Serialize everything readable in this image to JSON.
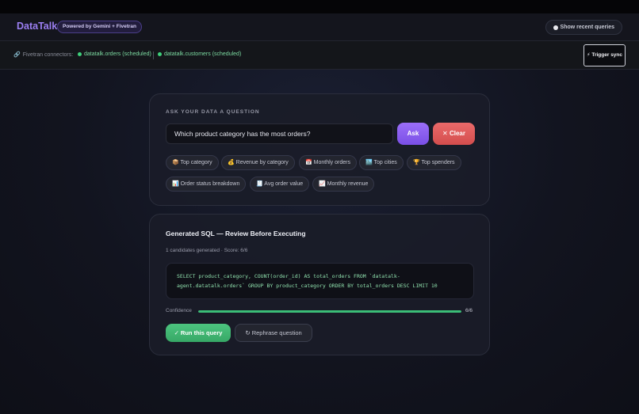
{
  "header": {
    "logo": "DataTalk",
    "badge": "Powered by Gemini + Fivetran",
    "recent_label": "Show recent queries"
  },
  "connectors": {
    "label": "Fivetran connectors:",
    "items": [
      "datatalk.orders (scheduled)",
      "datatalk.customers (scheduled)"
    ],
    "sync_label": "⚡ Trigger sync"
  },
  "ask": {
    "label": "ASK YOUR DATA A QUESTION",
    "input_value": "Which product category has the most orders?",
    "ask_button": "Ask",
    "clear_button": "✕ Clear",
    "suggestions": [
      "📦 Top category",
      "💰 Revenue by category",
      "📅 Monthly orders",
      "🏙️ Top cities",
      "🏆 Top spenders",
      "📊 Order status breakdown",
      "🧾 Avg order value",
      "📈 Monthly revenue"
    ]
  },
  "sql": {
    "title": "Generated SQL — Review Before Executing",
    "meta": "1 candidates generated · Score: 6/6",
    "query": "SELECT product_category, COUNT(order_id) AS total_orders FROM `datatalk-agent.datatalk.orders` GROUP BY product_category ORDER BY total_orders DESC LIMIT 10",
    "confidence_label": "Confidence",
    "confidence_value": "6/6",
    "confidence_fraction": 1.0,
    "run_button": "✓ Run this query",
    "rephrase_button": "↻ Rephrase question"
  },
  "colors": {
    "accent": "#9b7ff2",
    "ask": "#8a5ef0",
    "clear": "#e05c5c",
    "success": "#3ecf7a"
  }
}
